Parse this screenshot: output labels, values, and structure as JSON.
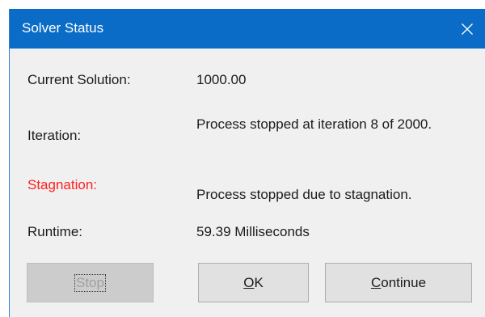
{
  "window": {
    "title": "Solver Status"
  },
  "fields": {
    "current_solution": {
      "label": "Current Solution:",
      "value": "1000.00"
    },
    "iteration": {
      "label": "Iteration:",
      "value": "Process stopped at iteration 8 of 2000."
    },
    "stagnation": {
      "label": "Stagnation:",
      "value": "Process stopped due to stagnation."
    },
    "runtime": {
      "label": "Runtime:",
      "value": "59.39 Milliseconds"
    }
  },
  "buttons": {
    "stop": {
      "label": "Stop",
      "enabled": false
    },
    "ok": {
      "label": "OK",
      "mnemonic": "O",
      "rest": "K"
    },
    "continue": {
      "label": "Continue",
      "mnemonic": "C",
      "rest": "ontinue"
    }
  },
  "colors": {
    "titlebar": "#0a6cc7",
    "dialog_bg": "#f0f0f0",
    "warning_label": "#ff2020"
  },
  "icons": {
    "close": "close-icon"
  }
}
